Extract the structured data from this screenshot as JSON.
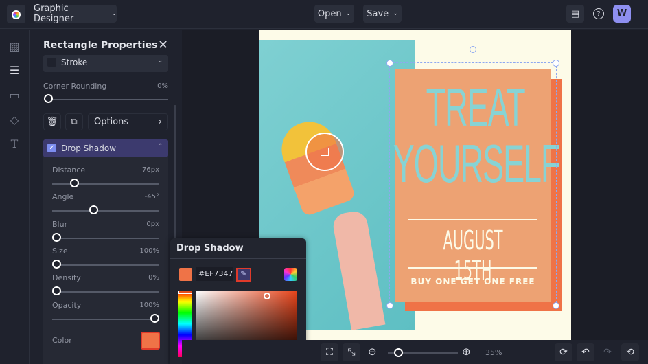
{
  "topbar": {
    "app_menu": "Graphic Designer",
    "open": "Open",
    "save": "Save",
    "avatar": "W"
  },
  "panel": {
    "title": "Rectangle Properties",
    "stroke": "Stroke",
    "corner_rounding": {
      "label": "Corner Rounding",
      "value": "0%",
      "fraction": 0
    },
    "options": "Options",
    "drop_shadow": {
      "label": "Drop Shadow",
      "checked": true
    },
    "sliders": [
      {
        "label": "Distance",
        "value": "76px",
        "fraction": 0.18
      },
      {
        "label": "Angle",
        "value": "-45°",
        "fraction": 0.38
      },
      {
        "label": "Blur",
        "value": "0px",
        "fraction": 0
      },
      {
        "label": "Size",
        "value": "100%",
        "fraction": 0
      },
      {
        "label": "Density",
        "value": "0%",
        "fraction": 0
      },
      {
        "label": "Opacity",
        "value": "100%",
        "fraction": 1
      }
    ],
    "color_label": "Color",
    "color": "#EF7347"
  },
  "popover": {
    "title": "Drop Shadow",
    "hex": "#EF7347"
  },
  "poster": {
    "line1": "TREAT",
    "line2": "YOURSELF",
    "date": "AUGUST 15TH",
    "promo": "BUY ONE GET ONE FREE"
  },
  "bottombar": {
    "zoom": "35%",
    "zoom_fraction": 0.1
  },
  "colors": {
    "accent": "#4d4a8f",
    "poster_bg": "#fdfbe8",
    "rect": "#eda273",
    "shadow": "#ef7347",
    "teal": "#87d3d4"
  }
}
